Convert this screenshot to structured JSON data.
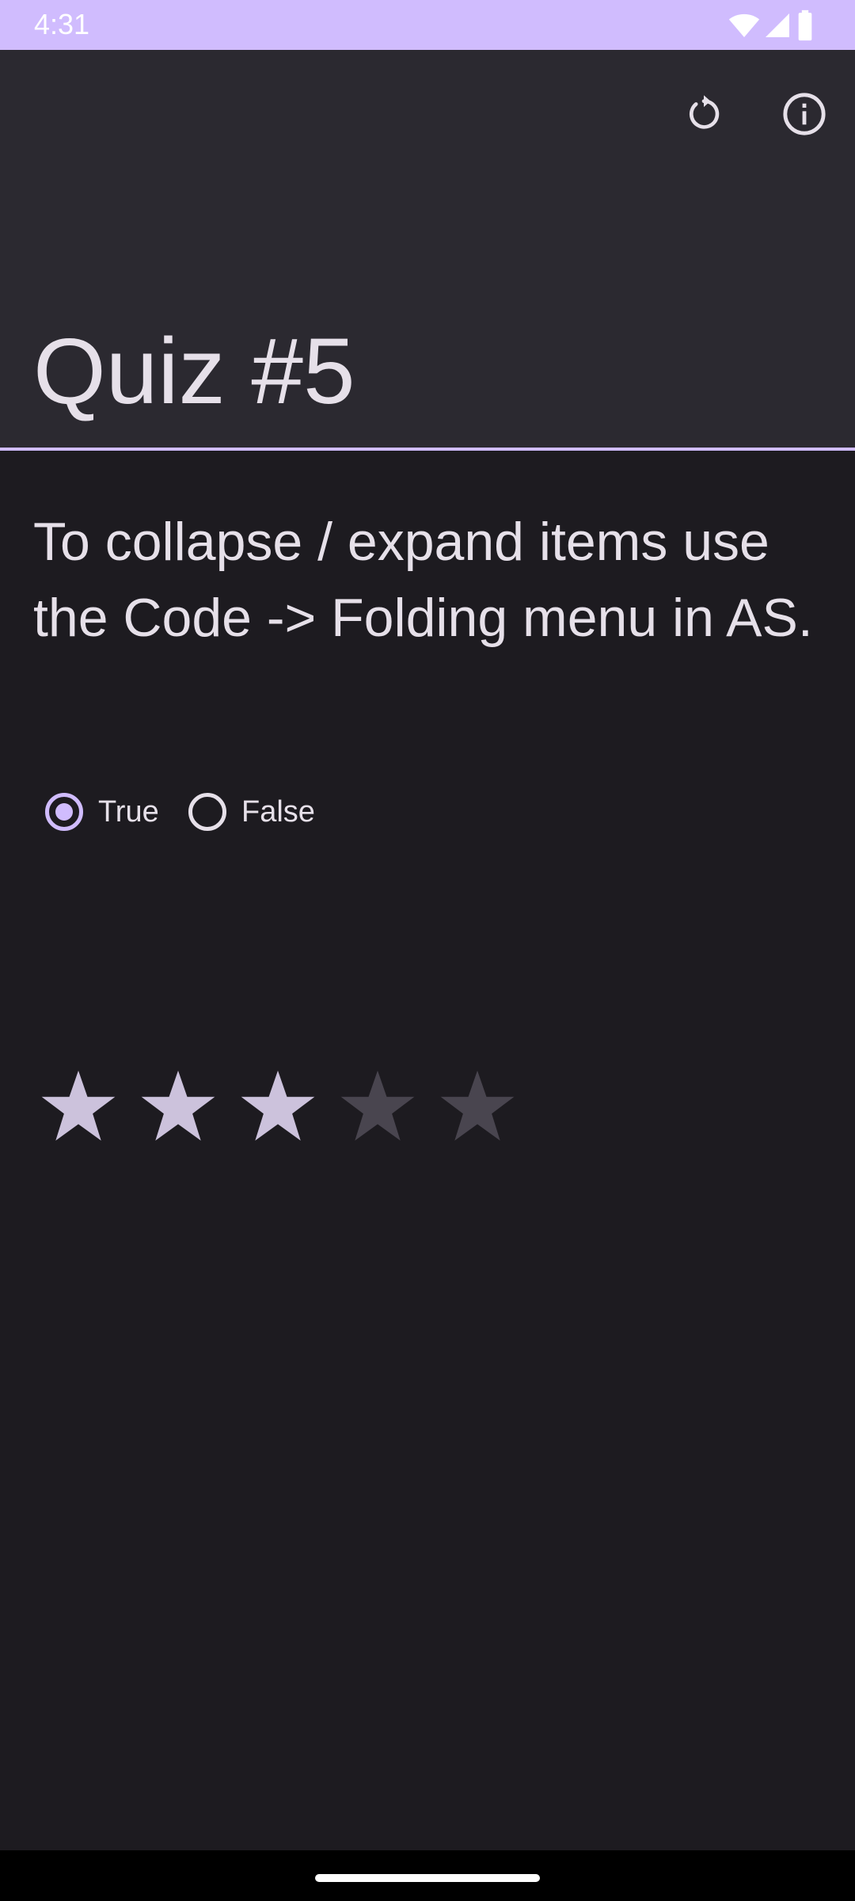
{
  "status_bar": {
    "time": "4:31",
    "icons": [
      "wifi-icon",
      "cellular-signal-icon",
      "battery-icon"
    ]
  },
  "app_bar": {
    "title": "Quiz #5",
    "actions": [
      {
        "name": "refresh-icon"
      },
      {
        "name": "info-icon"
      }
    ]
  },
  "question": {
    "text": "To collapse / expand items use the Code -> Folding menu in AS."
  },
  "answer": {
    "options": [
      "True",
      "False"
    ],
    "selected": "True"
  },
  "rating": {
    "value": 3,
    "max": 5
  },
  "colors": {
    "accent": "#d0bcfe",
    "background": "#1d1b20",
    "app_bar": "#2b2930",
    "star_filled": "#ccc2dc",
    "star_empty": "#49454f"
  }
}
